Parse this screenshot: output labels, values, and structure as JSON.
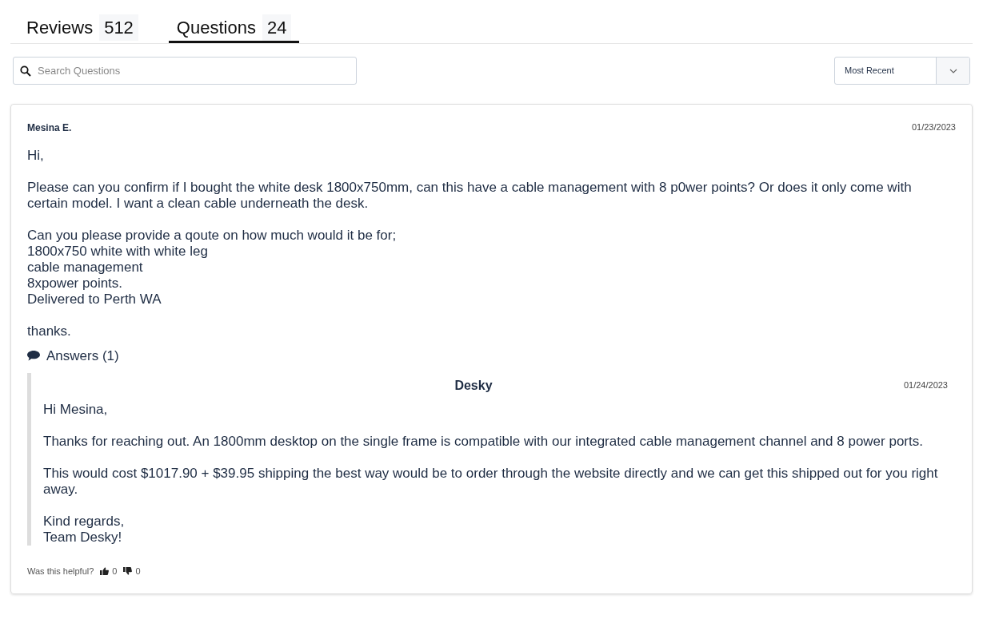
{
  "tabs": [
    {
      "label": "Reviews",
      "count": "512",
      "selected": false
    },
    {
      "label": "Questions",
      "count": "24",
      "selected": true
    }
  ],
  "search": {
    "placeholder": "Search Questions"
  },
  "sort": {
    "value": "Most Recent"
  },
  "question": {
    "author": "Mesina E.",
    "date": "01/23/2023",
    "paragraphs": [
      [
        "Hi,"
      ],
      [
        "Please can you confirm if I bought the white desk 1800x750mm, can this have a cable management with 8 p0wer points? Or does it only come with certain model. I want a clean cable underneath the desk."
      ],
      [
        "Can you please provide a qoute on how much would it be for;",
        "1800x750 white with white leg",
        "cable management",
        "8xpower points.",
        "Delivered to Perth WA"
      ],
      [
        "thanks."
      ]
    ],
    "answers_label": "Answers (1)",
    "answers": [
      {
        "author": "Desky",
        "date": "01/24/2023",
        "paragraphs": [
          [
            "Hi Mesina,"
          ],
          [
            "Thanks for reaching out. An 1800mm desktop on the single frame is compatible with our integrated cable management channel and 8 power ports."
          ],
          [
            "This would cost $1017.90 + $39.95 shipping the best way would be to order through the website directly and we can get this shipped out for you right away."
          ],
          [
            "Kind regards,",
            "Team Desky!"
          ]
        ]
      }
    ],
    "helpful": {
      "label": "Was this helpful?",
      "up": "0",
      "down": "0"
    }
  }
}
